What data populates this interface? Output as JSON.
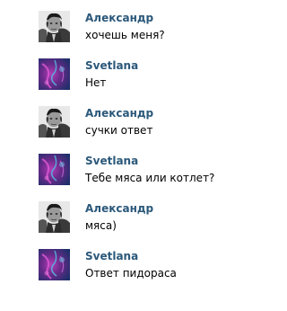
{
  "messages": [
    {
      "author": "Александр",
      "text": "хочешь меня?",
      "avatar": "man-photo"
    },
    {
      "author": "Svetlana",
      "text": "Нет",
      "avatar": "purple-abstract"
    },
    {
      "author": "Александр",
      "text": "сучки ответ",
      "avatar": "man-photo"
    },
    {
      "author": "Svetlana",
      "text": "Тебе мяса или котлет?",
      "avatar": "purple-abstract"
    },
    {
      "author": "Александр",
      "text": "мяса)",
      "avatar": "man-photo"
    },
    {
      "author": "Svetlana",
      "text": "Ответ пидораса",
      "avatar": "purple-abstract"
    }
  ],
  "colors": {
    "author": "#2b587a",
    "text": "#000000",
    "background": "#ffffff"
  }
}
